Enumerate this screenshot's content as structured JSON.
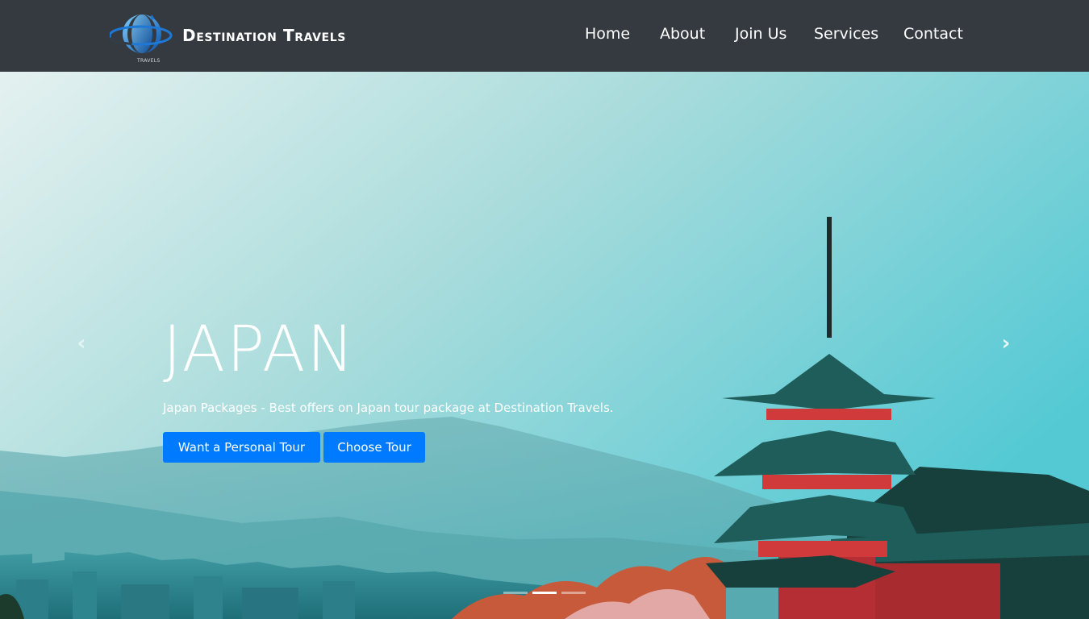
{
  "brand": {
    "name": "Destination Travels",
    "logo_subtext": "TRAVELS",
    "logo_icon": "globe-orbit-logo"
  },
  "nav": {
    "items": [
      {
        "label": "Home"
      },
      {
        "label": "About"
      },
      {
        "label": "Join Us"
      },
      {
        "label": "Services"
      },
      {
        "label": "Contact"
      }
    ]
  },
  "hero": {
    "title": "JAPAN",
    "subtitle": "Japan Packages - Best offers on Japan tour package at Destination Travels.",
    "buttons": {
      "personal_tour": "Want a Personal Tour",
      "choose_tour": "Choose Tour"
    },
    "prev_icon": "chevron-left-icon",
    "next_icon": "chevron-right-icon",
    "prev_glyph": "‹",
    "next_glyph": "›",
    "active_slide": 2,
    "slide_count": 3
  },
  "colors": {
    "navbar_bg": "#343a40",
    "button_bg": "#007bff",
    "sky_top": "#d9eeee",
    "sky_right": "#5ccfd8",
    "pagoda_red": "#d13a3a",
    "roof_teal": "#1f5d5a"
  }
}
